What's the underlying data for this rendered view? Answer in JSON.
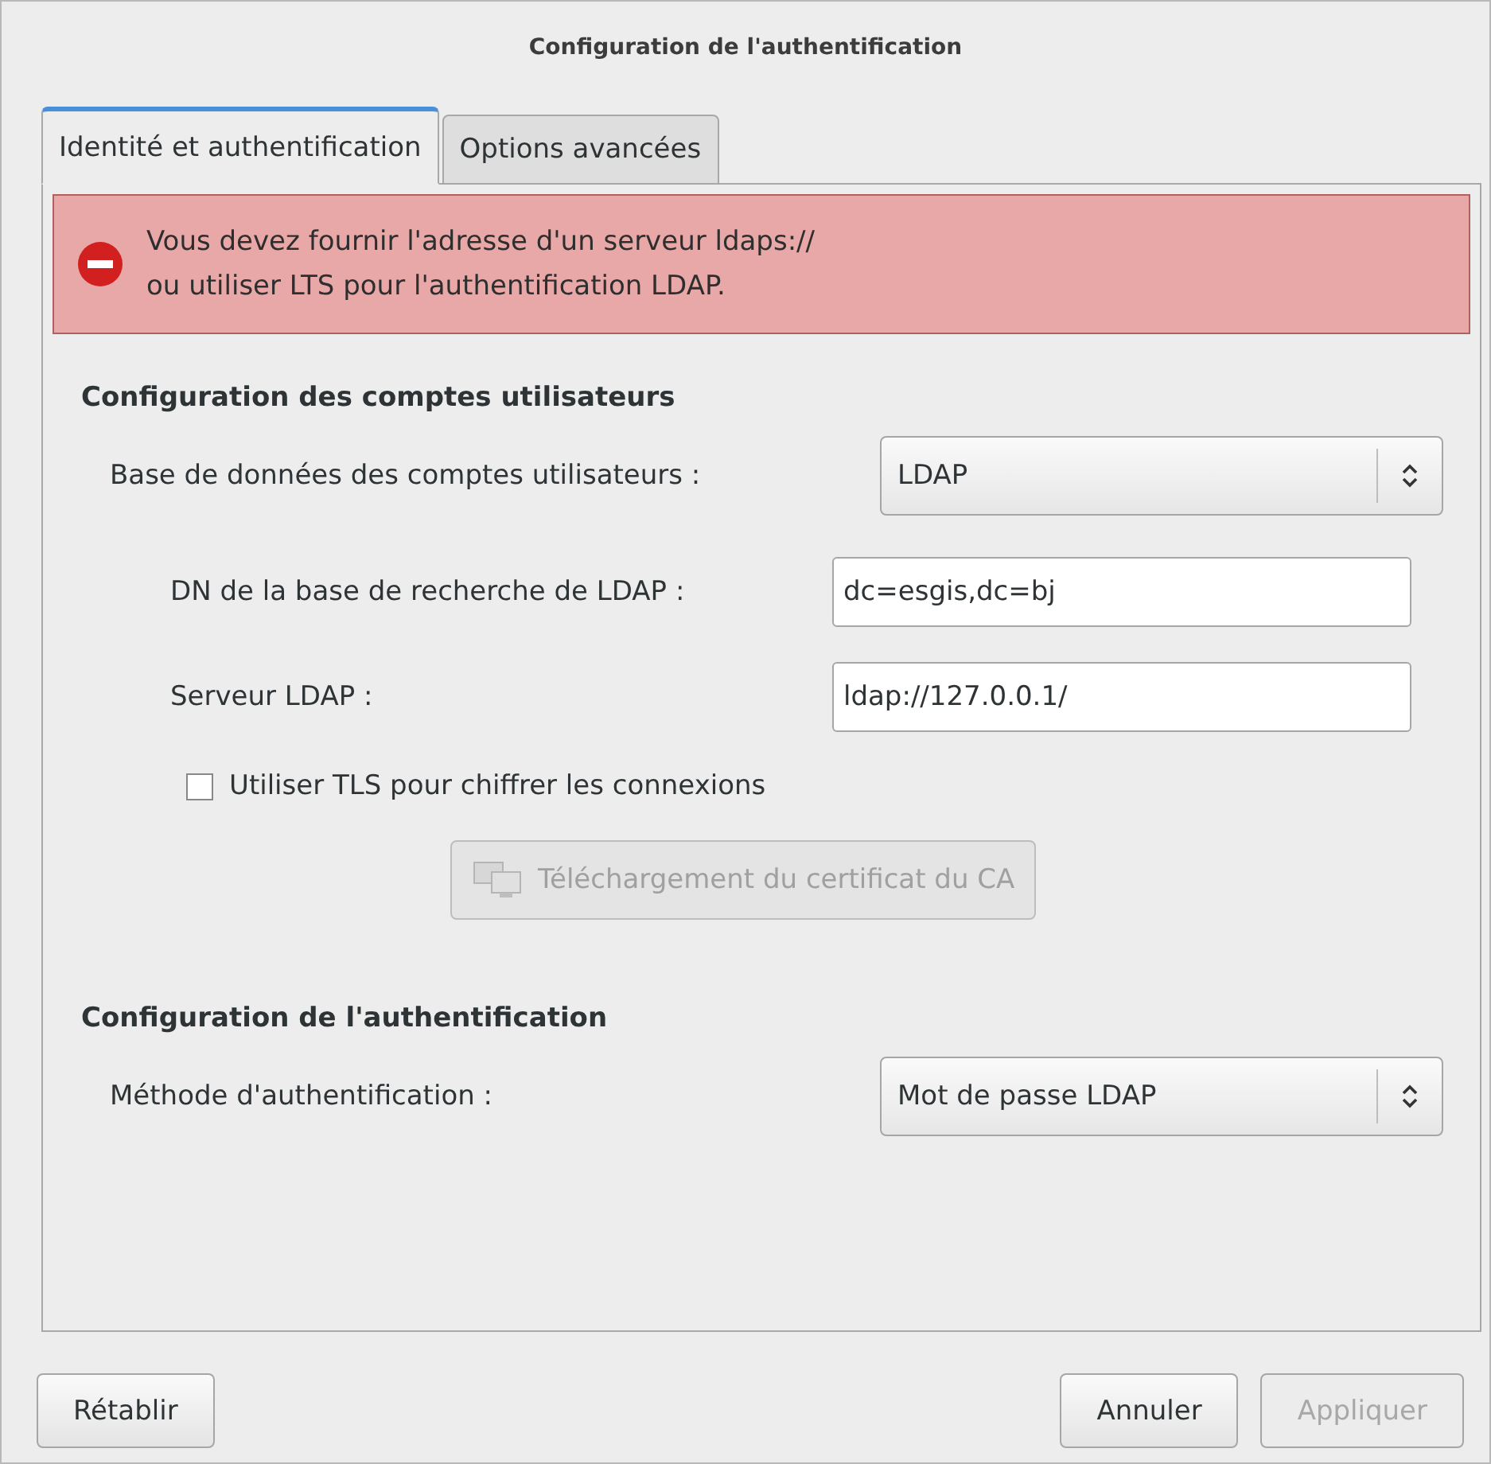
{
  "window": {
    "title": "Configuration de l'authentification"
  },
  "tabs": [
    {
      "label": "Identité et authentification",
      "selected": true
    },
    {
      "label": "Options avancées",
      "selected": false
    }
  ],
  "error": {
    "lines": [
      "Vous devez fournir l'adresse d'un serveur ldaps://",
      "ou utiliser LTS pour l'authentification LDAP."
    ]
  },
  "accounts": {
    "heading": "Configuration des comptes utilisateurs",
    "database_label": "Base de données des comptes utilisateurs :",
    "database_value": "LDAP",
    "fields": [
      {
        "label": "DN de la base de recherche de LDAP :",
        "value": "dc=esgis,dc=bj"
      },
      {
        "label": "Serveur LDAP :",
        "value": "ldap://127.0.0.1/"
      }
    ],
    "tls": {
      "label": "Utiliser TLS pour chiffrer les connexions",
      "checked": false
    },
    "download_button": {
      "label": "Téléchargement du certificat du CA",
      "disabled": true
    }
  },
  "auth": {
    "heading": "Configuration de l'authentification",
    "method_label": "Méthode d'authentification :",
    "method_value": "Mot de passe LDAP"
  },
  "buttons": [
    {
      "label": "Rétablir",
      "disabled": false
    },
    {
      "label": "Annuler",
      "disabled": false
    },
    {
      "label": "Appliquer",
      "disabled": true
    }
  ]
}
